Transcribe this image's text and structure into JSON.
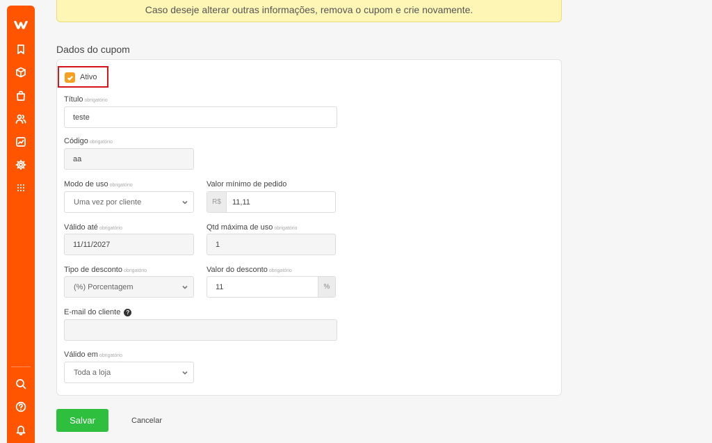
{
  "notice": {
    "text": "Caso deseje alterar outras informações, remova o cupom e crie novamente."
  },
  "section": {
    "title": "Dados do cupom"
  },
  "required_tag": "obrigatório",
  "form": {
    "active": {
      "label": "Ativo",
      "checked": true
    },
    "titulo": {
      "label": "Título",
      "value": "teste"
    },
    "codigo": {
      "label": "Código",
      "value": "aa"
    },
    "modo_uso": {
      "label": "Modo de uso",
      "value": "Uma vez por cliente"
    },
    "valor_minimo": {
      "label": "Valor mínimo de pedido",
      "prefix": "R$",
      "value": "11,11"
    },
    "valido_ate": {
      "label": "Válido até",
      "value": "11/11/2027"
    },
    "qtd_maxima": {
      "label": "Qtd máxima de uso",
      "value": "1"
    },
    "tipo_desconto": {
      "label": "Tipo de desconto",
      "value": "(%) Porcentagem"
    },
    "valor_desconto": {
      "label": "Valor do desconto",
      "value": "11",
      "suffix": "%"
    },
    "email_cliente": {
      "label": "E-mail do cliente",
      "value": "",
      "help_icon": "question-circle-icon"
    },
    "valido_em": {
      "label": "Válido em",
      "value": "Toda a loja"
    }
  },
  "actions": {
    "save_label": "Salvar",
    "cancel_label": "Cancelar"
  },
  "sidebar": {
    "icons": [
      "logo-icon",
      "bookmark-icon",
      "box-icon",
      "bag-icon",
      "users-icon",
      "chart-icon",
      "gear-icon",
      "grid-icon",
      "search-icon",
      "help-icon",
      "bell-icon"
    ]
  },
  "colors": {
    "brand": "#ff5500",
    "save": "#2fbf3f",
    "checkbox": "#f5a020",
    "notice_bg": "#fdf6b5",
    "highlight": "#d8141b"
  }
}
